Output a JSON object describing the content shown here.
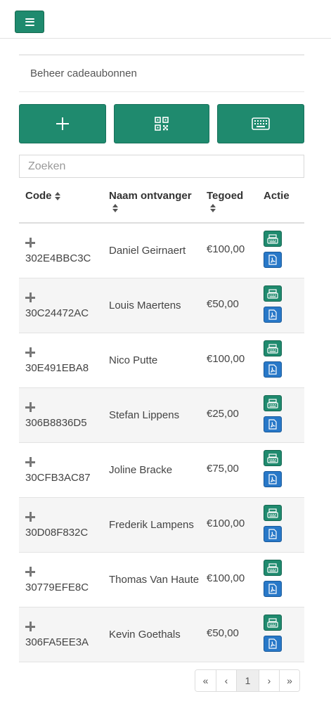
{
  "panel": {
    "title": "Beheer cadeaubonnen"
  },
  "search": {
    "placeholder": "Zoeken"
  },
  "table": {
    "headers": {
      "code": "Code",
      "name": "Naam ontvanger",
      "amount": "Tegoed",
      "action": "Actie"
    },
    "rows": [
      {
        "code": "302E4BBC3C",
        "name": "Daniel Geirnaert",
        "amount": "€100,00"
      },
      {
        "code": "30C24472AC",
        "name": "Louis Maertens",
        "amount": "€50,00"
      },
      {
        "code": "30E491EBA8",
        "name": "Nico Putte",
        "amount": "€100,00"
      },
      {
        "code": "306B8836D5",
        "name": "Stefan Lippens",
        "amount": "€25,00"
      },
      {
        "code": "30CFB3AC87",
        "name": "Joline Bracke",
        "amount": "€75,00"
      },
      {
        "code": "30D08F832C",
        "name": "Frederik Lampens",
        "amount": "€100,00"
      },
      {
        "code": "30779EFE8C",
        "name": "Thomas Van Haute",
        "amount": "€100,00"
      },
      {
        "code": "306FA5EE3A",
        "name": "Kevin Goethals",
        "amount": "€50,00"
      }
    ]
  },
  "pagination": {
    "first": "«",
    "prev": "‹",
    "current": "1",
    "next": "›",
    "last": "»"
  },
  "icons": {
    "menu": "hamburger-icon",
    "add": "plus-icon",
    "qr": "qr-code-icon",
    "keyboard": "keyboard-icon",
    "expand": "plus-icon",
    "register": "cash-register-icon",
    "pdf": "pdf-file-icon"
  },
  "colors": {
    "primary": "#1f8a6e",
    "pdf": "#2878c8"
  }
}
